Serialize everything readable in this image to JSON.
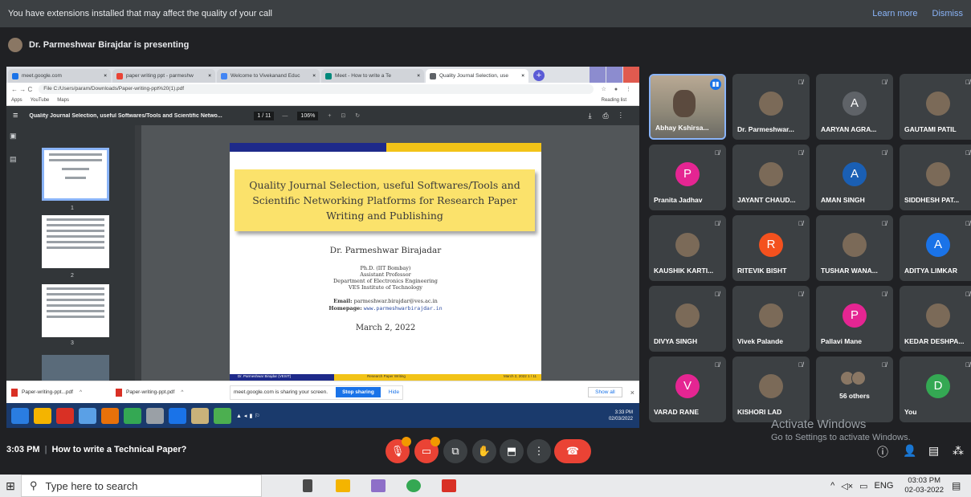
{
  "banner": {
    "message": "You have extensions installed that may affect the quality of your call",
    "learn_more": "Learn more",
    "dismiss": "Dismiss"
  },
  "presenting": {
    "text": "Dr. Parmeshwar Birajdar is presenting"
  },
  "browser": {
    "tabs": [
      {
        "label": "meet.google.com",
        "color": "#1a73e8"
      },
      {
        "label": "paper writing ppt - parmeshw",
        "color": "#ea4335"
      },
      {
        "label": "Welcome to Vivekanand Educ",
        "color": "#4285f4"
      },
      {
        "label": "Meet - How to write a Te",
        "color": "#00897b"
      },
      {
        "label": "Quality Journal Selection, use",
        "color": "#5f6368"
      }
    ],
    "url": "File  C:/Users/param/Downloads/Paper-writing-ppt%20(1).pdf",
    "bookmarks": [
      "Apps",
      "YouTube",
      "Maps"
    ],
    "reading_list": "Reading list"
  },
  "pdf": {
    "title": "Quality Journal Selection, useful Softwares/Tools and Scientific Netwo...",
    "page": "1 / 11",
    "zoom": "106%",
    "thumb_numbers": [
      "1",
      "2",
      "3"
    ]
  },
  "slide": {
    "title": "Quality Journal Selection, useful Softwares/Tools and Scientific Networking Platforms for Research Paper Writing and Publishing",
    "author": "Dr. Parmeshwar Birajadar",
    "affiliation": [
      "Ph.D. (IIT Bombay)",
      "Assistant Professor",
      "Department of Electronics Engineering",
      "VES Institute of Technology"
    ],
    "email_label": "Email:",
    "email": "parmeshwar.birajdar@ves.ac.in",
    "homepage_label": "Homepage:",
    "homepage": "www.parmeshwarbirajdar.in",
    "date": "March 2, 2022",
    "footer_left": "Dr. Parmeshwar Birajdar (VESIT)",
    "footer_mid": "Research Paper Writing",
    "footer_right": "March 2, 2022     1 / 11"
  },
  "downloads": {
    "items": [
      "Paper-writing-ppt...pdf",
      "Paper-writing-ppt.pdf"
    ],
    "share_msg": "meet.google.com is sharing your screen.",
    "stop_sharing": "Stop sharing",
    "hide": "Hide",
    "show_all": "Show all"
  },
  "inner_tray": {
    "time": "3:33 PM",
    "date": "02/03/2022"
  },
  "participants": [
    {
      "name": "Abhay Kshirsa...",
      "type": "video"
    },
    {
      "name": "Dr. Parmeshwar...",
      "type": "photo"
    },
    {
      "name": "AARYAN AGRA...",
      "type": "letter",
      "letter": "A",
      "color": "#5f6368"
    },
    {
      "name": "GAUTAMI PATIL",
      "type": "photo"
    },
    {
      "name": "Pranita Jadhav",
      "type": "letter",
      "letter": "P",
      "color": "#e52592"
    },
    {
      "name": "JAYANT CHAUD...",
      "type": "photo"
    },
    {
      "name": "AMAN SINGH",
      "type": "letter",
      "letter": "A",
      "color": "#1a5fb4"
    },
    {
      "name": "SIDDHESH PAT...",
      "type": "photo"
    },
    {
      "name": "KAUSHIK KARTI...",
      "type": "photo"
    },
    {
      "name": "RITEVIK BISHT",
      "type": "letter",
      "letter": "R",
      "color": "#f4511e"
    },
    {
      "name": "TUSHAR WANA...",
      "type": "photo"
    },
    {
      "name": "ADITYA LIMKAR",
      "type": "letter",
      "letter": "A",
      "color": "#1a73e8"
    },
    {
      "name": "DIVYA SINGH",
      "type": "photo"
    },
    {
      "name": "Vivek Palande",
      "type": "photo"
    },
    {
      "name": "Pallavi Mane",
      "type": "letter",
      "letter": "P",
      "color": "#e52592"
    },
    {
      "name": "KEDAR DESHPA...",
      "type": "photo"
    },
    {
      "name": "VARAD RANE",
      "type": "letter",
      "letter": "V",
      "color": "#e52592"
    },
    {
      "name": "KISHORI LAD",
      "type": "photo"
    },
    {
      "name": "56 others",
      "type": "others"
    },
    {
      "name": "You",
      "type": "letter",
      "letter": "D",
      "color": "#34a853"
    }
  ],
  "activate": {
    "line1": "Activate Windows",
    "line2": "Go to Settings to activate Windows."
  },
  "meeting": {
    "time": "3:03 PM",
    "title": "How to write a Technical Paper?"
  },
  "taskbar": {
    "search_placeholder": "Type here to search",
    "lang": "ENG",
    "time": "03:03 PM",
    "date": "02-03-2022"
  }
}
